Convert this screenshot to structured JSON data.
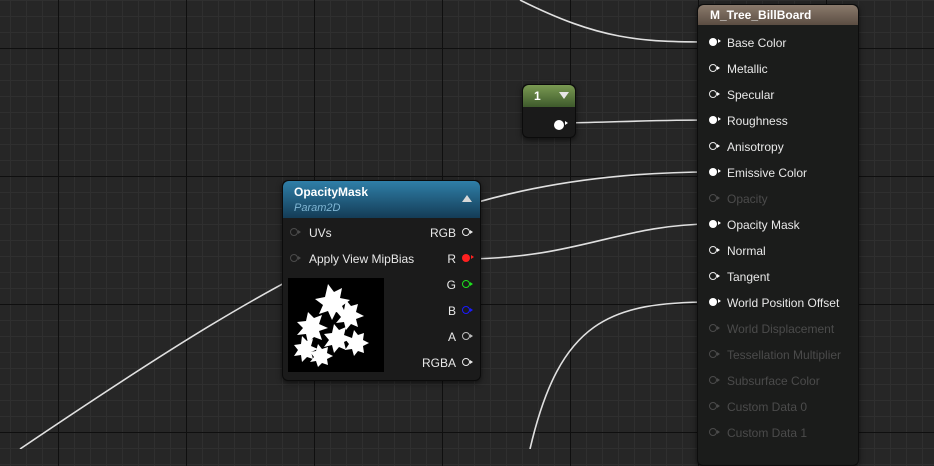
{
  "material_node": {
    "title": "M_Tree_BillBoard",
    "inputs": [
      {
        "label": "Base Color",
        "state": "connected"
      },
      {
        "label": "Metallic",
        "state": "active"
      },
      {
        "label": "Specular",
        "state": "active"
      },
      {
        "label": "Roughness",
        "state": "connected"
      },
      {
        "label": "Anisotropy",
        "state": "active"
      },
      {
        "label": "Emissive Color",
        "state": "connected"
      },
      {
        "label": "Opacity",
        "state": "disabled"
      },
      {
        "label": "Opacity Mask",
        "state": "connected"
      },
      {
        "label": "Normal",
        "state": "active"
      },
      {
        "label": "Tangent",
        "state": "active"
      },
      {
        "label": "World Position Offset",
        "state": "connected"
      },
      {
        "label": "World Displacement",
        "state": "disabled"
      },
      {
        "label": "Tessellation Multiplier",
        "state": "disabled"
      },
      {
        "label": "Subsurface Color",
        "state": "disabled"
      },
      {
        "label": "Custom Data 0",
        "state": "disabled"
      },
      {
        "label": "Custom Data 1",
        "state": "disabled"
      }
    ]
  },
  "constant_node": {
    "value": "1"
  },
  "opacity_node": {
    "title": "OpacityMask",
    "subtitle": "Param2D",
    "inputs": [
      "UVs",
      "Apply View MipBias"
    ],
    "outputs": [
      {
        "label": "RGB",
        "color": "#e8e8e8"
      },
      {
        "label": "R",
        "color": "#ff2020"
      },
      {
        "label": "G",
        "color": "#1ee01e"
      },
      {
        "label": "B",
        "color": "#1a1aff"
      },
      {
        "label": "A",
        "color": "#bdbdbd"
      },
      {
        "label": "RGBA",
        "color": "#e8e8e8"
      }
    ]
  },
  "colors": {
    "wire": "#e0e0e0",
    "text_active": "#e8e8e8",
    "text_disabled": "#4b4b4b"
  }
}
